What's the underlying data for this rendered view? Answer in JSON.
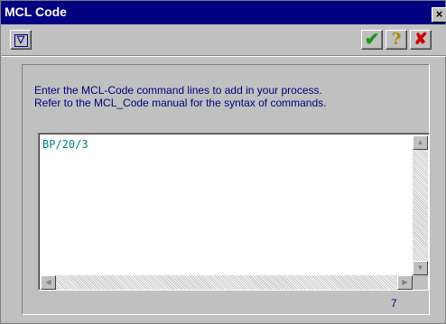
{
  "window": {
    "title": "MCL Code",
    "close_glyph": "×"
  },
  "toolbar": {
    "dropdown_icon": "▽",
    "ok_icon": "✔",
    "help_icon": "?",
    "cancel_icon": "✘"
  },
  "instructions": {
    "line1": "Enter the MCL-Code command lines to add in your process.",
    "line2": "Refer to the MCL_Code manual for the syntax of commands."
  },
  "editor": {
    "content": "BP/20/3",
    "line_count": "7"
  },
  "scrollbars": {
    "up_arrow": "▲",
    "down_arrow": "▼",
    "left_arrow": "◀",
    "right_arrow": "▶"
  },
  "colors": {
    "title_bar": "#000080",
    "face": "#c0c0c0",
    "text_accent": "#000080",
    "code_text": "#008080",
    "ok_green": "#1a9a1a",
    "help_yellow": "#b08800",
    "cancel_red": "#cc0000"
  }
}
